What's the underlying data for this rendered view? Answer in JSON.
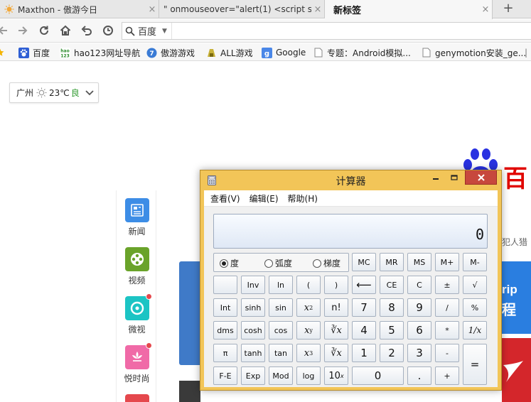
{
  "browser": {
    "tabs": [
      {
        "title": "Maxthon - 傲游今日",
        "close": "×"
      },
      {
        "title": "\" onmouseover=\"alert(1) <script s...",
        "close": "×"
      },
      {
        "title": "新标签",
        "close": "×"
      }
    ],
    "new_tab": "+",
    "search_engine": "百度",
    "address_value": ""
  },
  "bookmarks": [
    {
      "label": "百度",
      "icon": "baidu-paw-icon"
    },
    {
      "label": "hao123网址导航",
      "icon": "hao123-icon"
    },
    {
      "label": "傲游游戏",
      "icon": "maxthon-game-icon"
    },
    {
      "label": "ALL游戏",
      "icon": "all-game-icon"
    },
    {
      "label": "Google",
      "icon": "google-icon"
    },
    {
      "label": "专题：Android模拟...",
      "icon": "page-icon"
    },
    {
      "label": "genymotion安装_ge...",
      "icon": "page-icon"
    }
  ],
  "weather": {
    "city": "广州",
    "temp": "23℃",
    "air": "良"
  },
  "side_apps": [
    {
      "label": "新闻",
      "color": "#3d8de6"
    },
    {
      "label": "视频",
      "color": "#6aa32a"
    },
    {
      "label": "微视",
      "color": "#1cc4c4"
    },
    {
      "label": "悦时尚",
      "color": "#f06aa7"
    }
  ],
  "background_text": {
    "baidu_partial": "百",
    "snippet": "犯人猎",
    "trip": "rip",
    "ctrip": "程"
  },
  "calculator": {
    "title": "计算器",
    "menus": [
      "查看(V)",
      "编辑(E)",
      "帮助(H)"
    ],
    "display": "0",
    "angle_modes": [
      {
        "label": "度",
        "selected": true
      },
      {
        "label": "弧度",
        "selected": false
      },
      {
        "label": "梯度",
        "selected": false
      }
    ],
    "memory_keys": [
      "MC",
      "MR",
      "MS",
      "M+",
      "M-"
    ],
    "keys": {
      "inv": "Inv",
      "ln": "ln",
      "lparen": "(",
      "rparen": ")",
      "back": "⟵",
      "ce": "CE",
      "c": "C",
      "pm": "±",
      "sqrt": "√",
      "int": "Int",
      "sinh": "sinh",
      "sin": "sin",
      "x2": "x",
      "x2_sup": "2",
      "nfact": "n!",
      "n7": "7",
      "n8": "8",
      "n9": "9",
      "div": "/",
      "pct": "%",
      "dms": "dms",
      "cosh": "cosh",
      "cos": "cos",
      "xy": "x",
      "xy_sup": "y",
      "yroot": "∛x",
      "n4": "4",
      "n5": "5",
      "n6": "6",
      "mul": "*",
      "recip": "1/x",
      "pi": "π",
      "tanh": "tanh",
      "tan": "tan",
      "x3": "x",
      "x3_sup": "3",
      "cbrt": "∛x",
      "n1": "1",
      "n2": "2",
      "n3": "3",
      "sub": "-",
      "eq": "=",
      "fe": "F-E",
      "exp": "Exp",
      "mod": "Mod",
      "log": "log",
      "tenx": "10",
      "tenx_sup": "x",
      "n0": "0",
      "dot": ".",
      "add": "+"
    }
  }
}
